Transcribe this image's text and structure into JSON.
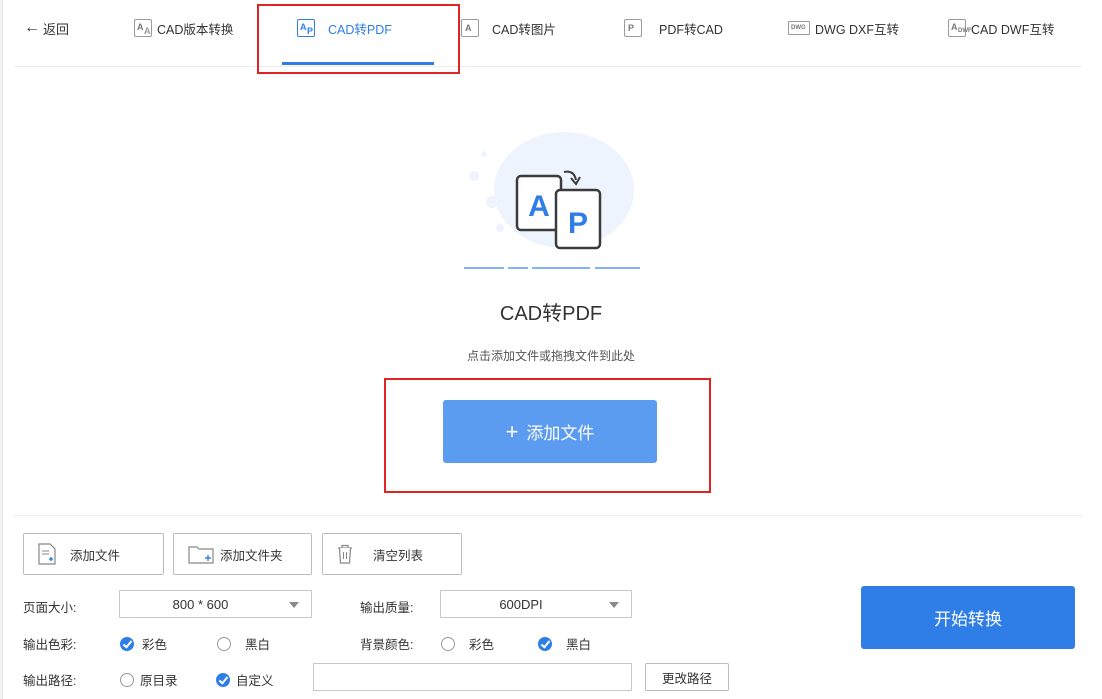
{
  "nav": {
    "back_label": "返回",
    "tabs": [
      {
        "label": "CAD版本转换",
        "icon": "cad-version-icon"
      },
      {
        "label": "CAD转PDF",
        "icon": "cad-to-pdf-icon",
        "active": true
      },
      {
        "label": "CAD转图片",
        "icon": "cad-to-image-icon"
      },
      {
        "label": "PDF转CAD",
        "icon": "pdf-to-cad-icon"
      },
      {
        "label": "DWG DXF互转",
        "icon": "dwg-dxf-icon"
      },
      {
        "label": "CAD DWF互转",
        "icon": "cad-dwf-icon"
      }
    ]
  },
  "main": {
    "title": "CAD转PDF",
    "hint": "点击添加文件或拖拽文件到此处",
    "add_button": "添加文件"
  },
  "toolbar": {
    "add_file": "添加文件",
    "add_folder": "添加文件夹",
    "clear_list": "清空列表"
  },
  "settings": {
    "page_size_label": "页面大小:",
    "page_size_value": "800 * 600",
    "quality_label": "输出质量:",
    "quality_value": "600DPI",
    "color_label": "输出色彩:",
    "color_option_color": "彩色",
    "color_option_bw": "黑白",
    "color_selected": "彩色",
    "bg_label": "背景颜色:",
    "bg_option_color": "彩色",
    "bg_option_bw": "黑白",
    "bg_selected": "黑白",
    "path_label": "输出路径:",
    "path_option_original": "原目录",
    "path_option_custom": "自定义",
    "path_selected": "自定义",
    "path_value": "",
    "change_path_button": "更改路径"
  },
  "start_button": "开始转换",
  "colors": {
    "accent": "#2f7ee8",
    "add_button": "#5b9bf0",
    "highlight_box": "#e02424"
  }
}
